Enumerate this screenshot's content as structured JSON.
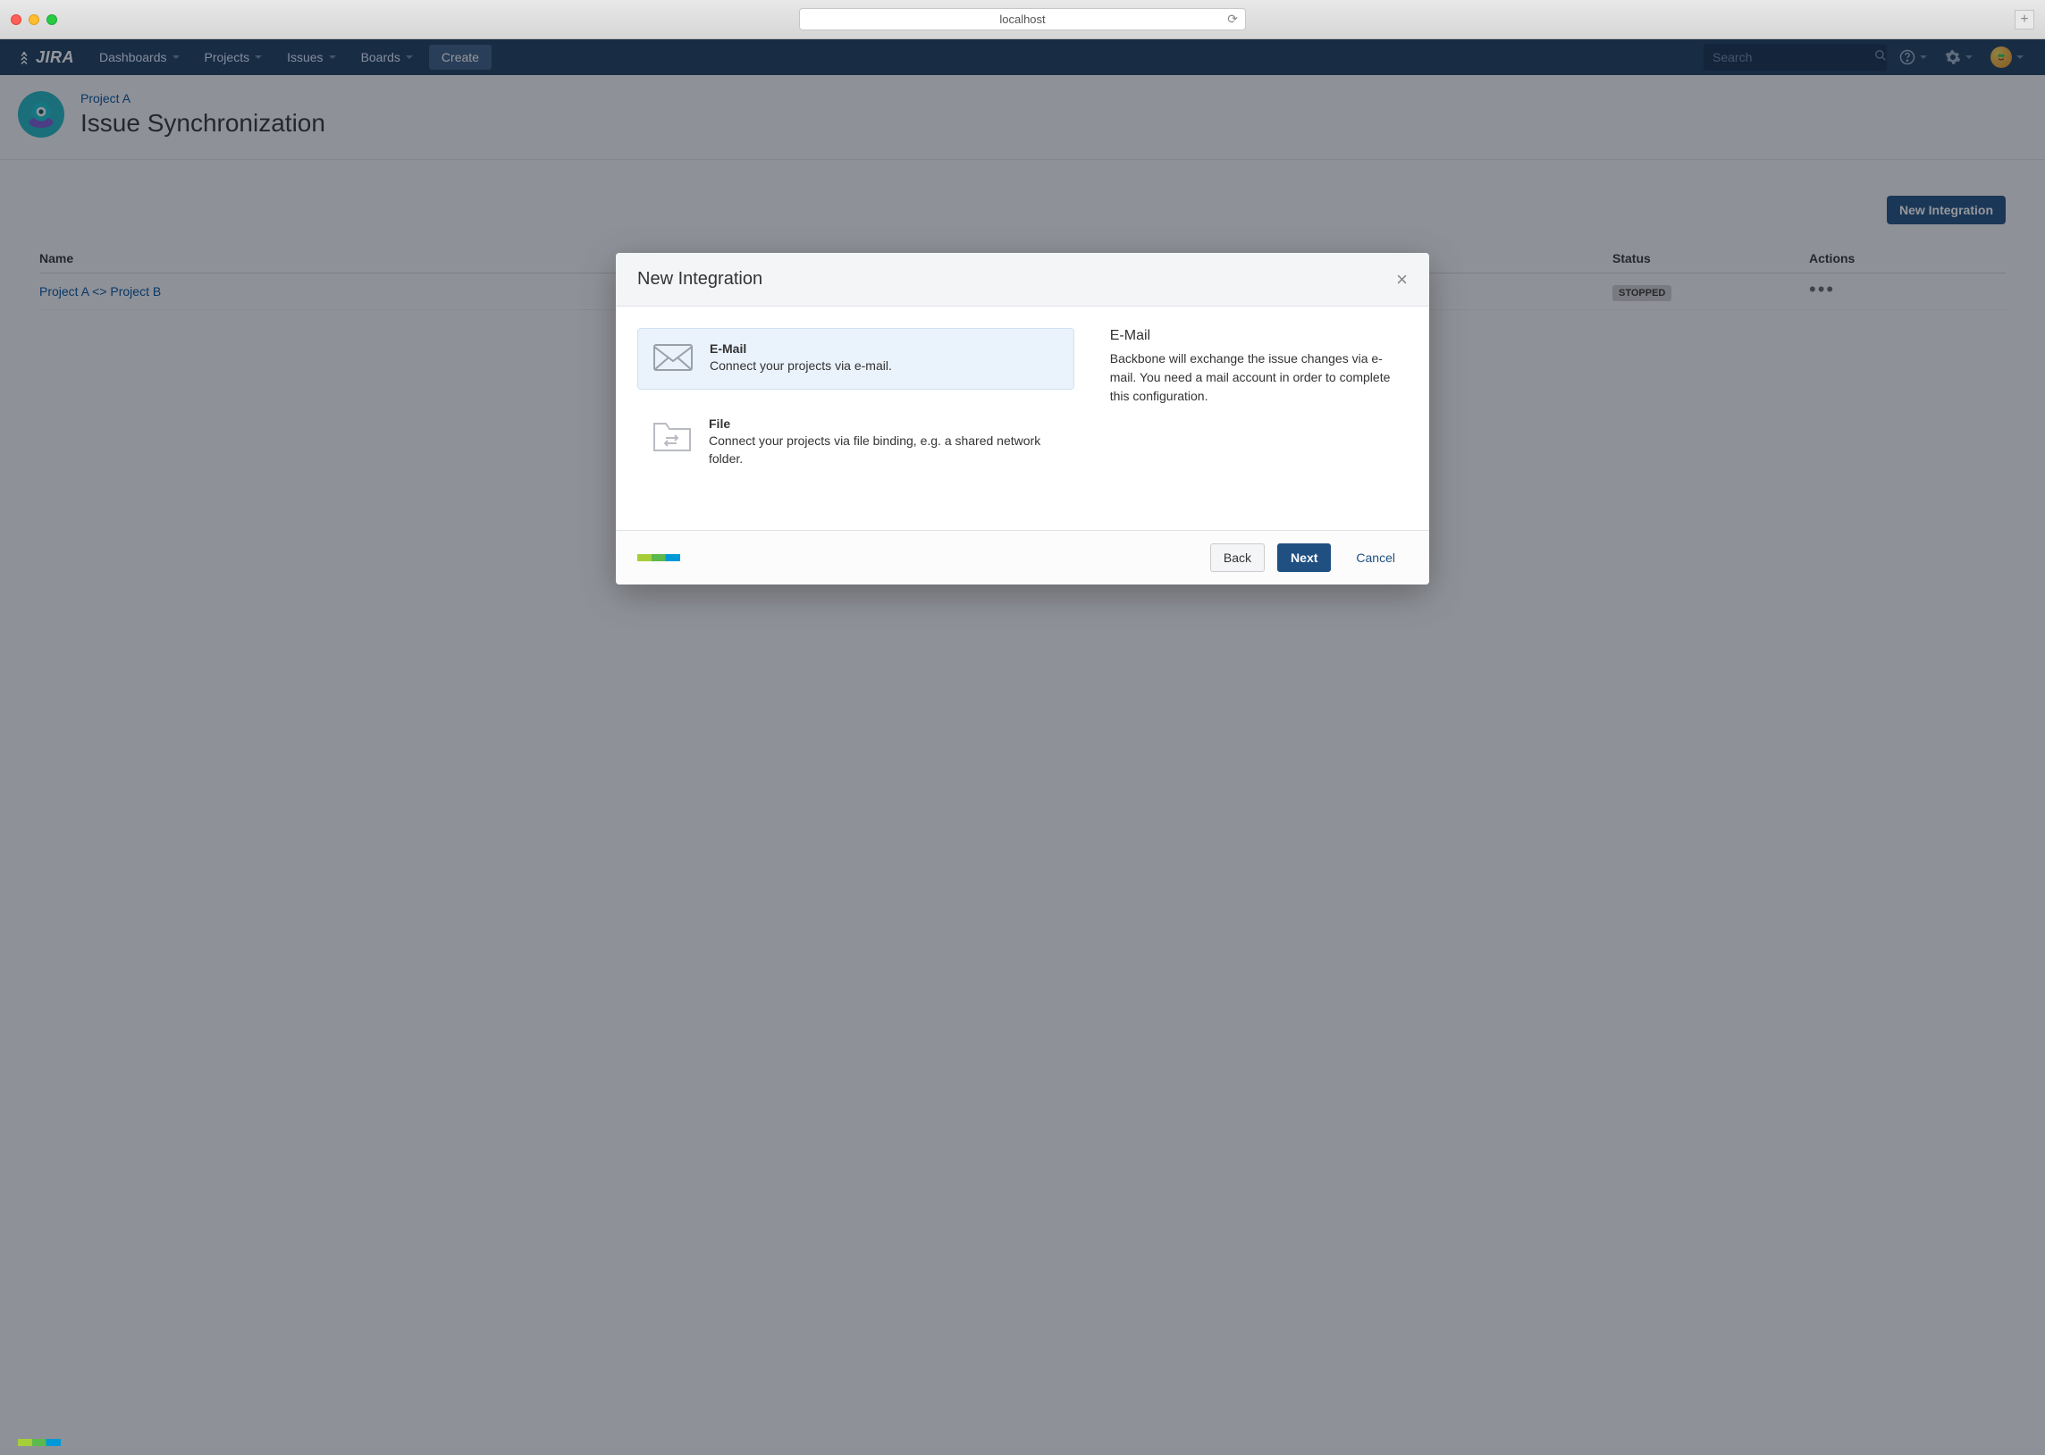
{
  "browser": {
    "url": "localhost"
  },
  "nav": {
    "logo": "JIRA",
    "items": [
      "Dashboards",
      "Projects",
      "Issues",
      "Boards"
    ],
    "create": "Create",
    "search_placeholder": "Search"
  },
  "header": {
    "breadcrumb": "Project A",
    "title": "Issue Synchronization"
  },
  "actions": {
    "new_integration": "New Integration"
  },
  "table": {
    "columns": {
      "name": "Name",
      "status": "Status",
      "actions": "Actions"
    },
    "rows": [
      {
        "name": "Project A <> Project B",
        "status": "STOPPED"
      }
    ]
  },
  "modal": {
    "title": "New Integration",
    "options": [
      {
        "id": "email",
        "title": "E-Mail",
        "desc": "Connect your projects via e-mail.",
        "selected": true
      },
      {
        "id": "file",
        "title": "File",
        "desc": "Connect your projects via file binding, e.g. a shared network folder.",
        "selected": false
      }
    ],
    "detail": {
      "title": "E-Mail",
      "text": "Backbone will exchange the issue changes via e-mail. You need a mail account in order to complete this configuration."
    },
    "footer": {
      "back": "Back",
      "next": "Next",
      "cancel": "Cancel"
    }
  }
}
